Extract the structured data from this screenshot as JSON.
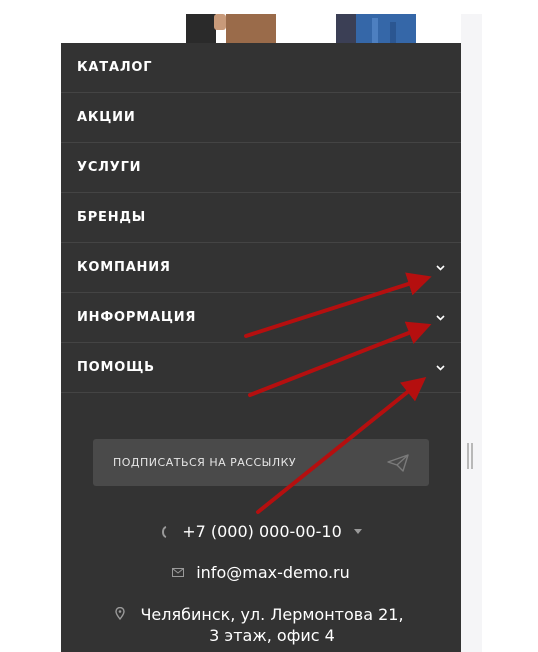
{
  "menu": {
    "items": [
      {
        "label": "КАТАЛОГ",
        "has_submenu": false
      },
      {
        "label": "АКЦИИ",
        "has_submenu": false
      },
      {
        "label": "УСЛУГИ",
        "has_submenu": false
      },
      {
        "label": "БРЕНДЫ",
        "has_submenu": false
      },
      {
        "label": "КОМПАНИЯ",
        "has_submenu": true
      },
      {
        "label": "ИНФОРМАЦИЯ",
        "has_submenu": true
      },
      {
        "label": "ПОМОЩЬ",
        "has_submenu": true
      }
    ]
  },
  "subscribe": {
    "label": "ПОДПИСАТЬСЯ НА РАССЫЛКУ",
    "icon": "send-icon"
  },
  "contacts": {
    "phone": "+7 (000) 000-00-10",
    "email": "info@max-demo.ru",
    "address": "Челябинск, ул. Лермонтова 21, 3 этаж, офис 4"
  },
  "colors": {
    "panel_bg": "#333333",
    "divider": "#444444",
    "subscribe_bg": "#4a4a4a",
    "annotation_arrow": "#b50f0f"
  }
}
